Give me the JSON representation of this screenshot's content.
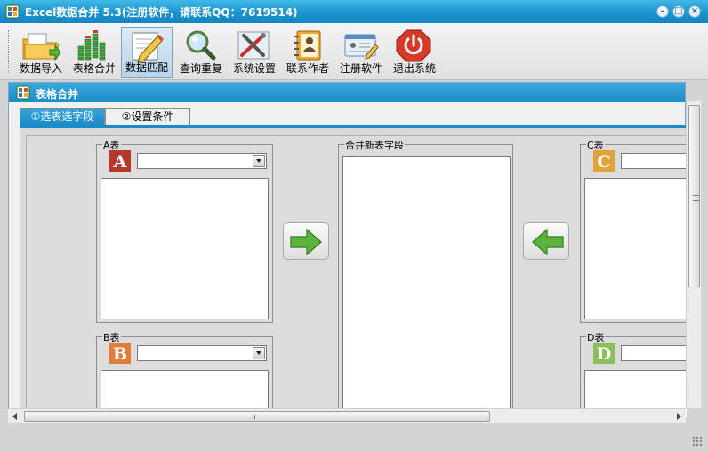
{
  "window": {
    "title": "Excel数据合并  5.3(注册软件，请联系QQ：7619514)",
    "icon": "app-grid-icon"
  },
  "toolbar": {
    "items": [
      {
        "label": "数据导入",
        "icon": "folder-import-icon",
        "active": false
      },
      {
        "label": "表格合并",
        "icon": "bar-chart-icon",
        "active": false
      },
      {
        "label": "数据匹配",
        "icon": "pencil-edit-icon",
        "active": true
      },
      {
        "label": "查询重复",
        "icon": "magnifier-icon",
        "active": false
      },
      {
        "label": "系统设置",
        "icon": "tools-icon",
        "active": false
      },
      {
        "label": "联系作者",
        "icon": "address-book-icon",
        "active": false
      },
      {
        "label": "注册软件",
        "icon": "id-card-icon",
        "active": false
      },
      {
        "label": "退出系统",
        "icon": "power-icon",
        "active": false
      }
    ]
  },
  "panel": {
    "title": "表格合并",
    "tabs": [
      {
        "label": "①选表选字段",
        "selected": true
      },
      {
        "label": "②设置条件",
        "selected": false
      }
    ]
  },
  "groups": {
    "a": {
      "title": "A表",
      "letter": "A",
      "selected_value": ""
    },
    "b": {
      "title": "B表",
      "letter": "B",
      "selected_value": ""
    },
    "c": {
      "title": "C表",
      "letter": "C",
      "selected_value": ""
    },
    "d": {
      "title": "D表",
      "letter": "D",
      "selected_value": ""
    },
    "merge": {
      "title": "合并新表字段"
    }
  },
  "colors": {
    "title_bar": "#1b93cf",
    "accent": "#1a8bc6",
    "badge_a": "#b33a2a",
    "badge_b": "#e07d3c",
    "badge_c": "#e2a23a",
    "badge_d": "#8cbf5a",
    "arrow_green": "#5bb53a"
  }
}
